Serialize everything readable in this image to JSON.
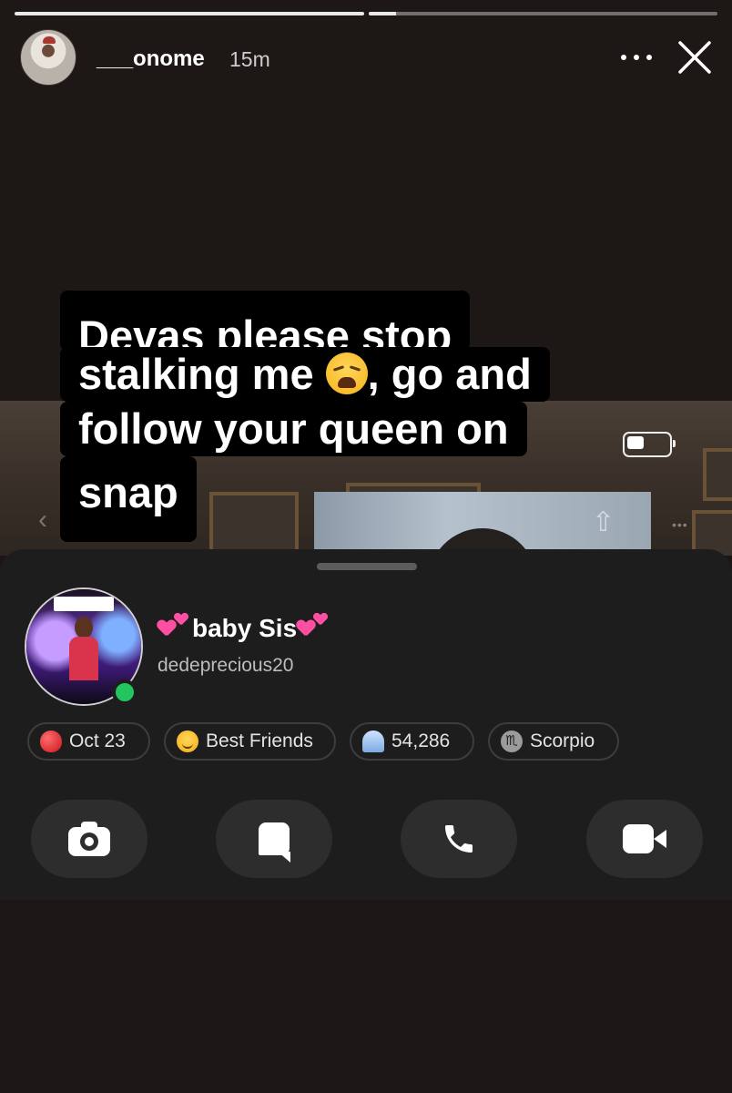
{
  "story": {
    "progress": [
      1.0,
      0.08
    ],
    "user": "___onome",
    "time": "15m",
    "more_icon": "more-horizontal-icon",
    "close_icon": "close-icon"
  },
  "caption": {
    "line1": "Devas please stop",
    "line2_pre": "stalking me ",
    "line2_emoji": "weary-face-emoji",
    "line2_post": ", go and",
    "line3": "follow your queen on",
    "line4": "snap"
  },
  "profile": {
    "display_name": "baby Sis",
    "username": "dedeprecious20",
    "online": true,
    "chips": [
      {
        "icon": "balloon-icon",
        "label": "Oct 23"
      },
      {
        "icon": "smile-icon",
        "label": "Best Friends"
      },
      {
        "icon": "ghost-icon",
        "label": "54,286"
      },
      {
        "icon": "scorpio-icon",
        "label": "Scorpio",
        "glyph": "♏"
      }
    ],
    "actions": [
      "camera",
      "chat",
      "call",
      "video"
    ]
  },
  "colors": {
    "background": "#1b1615",
    "sheet": "#1d1d1d",
    "action_button": "#2d2d2d",
    "online": "#22c55e",
    "heart": "#ff4fa3"
  }
}
